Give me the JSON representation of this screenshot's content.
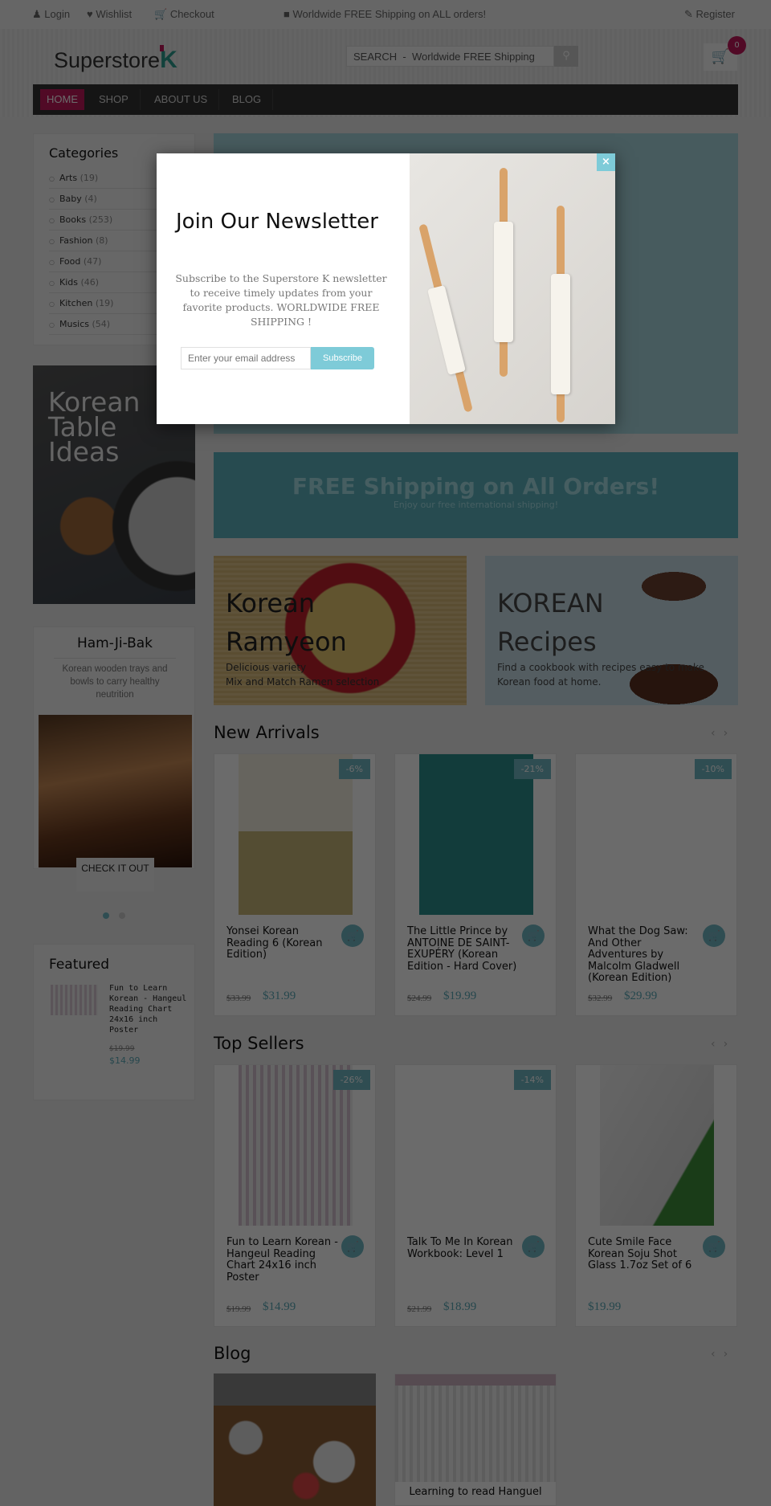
{
  "topbar": {
    "login": "Login",
    "wishlist": "Wishlist",
    "checkout": "Checkout",
    "shipping": "Worldwide FREE Shipping on ALL orders!",
    "register": "Register"
  },
  "header": {
    "logo": "Superstore",
    "logo_k": "K",
    "search_placeholder": "SEARCH  -  Worldwide FREE Shipping",
    "cart_count": "0"
  },
  "nav": [
    "HOME",
    "SHOP",
    "ABOUT US",
    "BLOG"
  ],
  "colors": {
    "accent": "#c2185b",
    "teal": "#6fb7c4",
    "nav_bg": "#333333"
  },
  "sidebar": {
    "categories_title": "Categories",
    "categories": [
      {
        "name": "Arts",
        "count": "(19)"
      },
      {
        "name": "Baby",
        "count": "(4)"
      },
      {
        "name": "Books",
        "count": "(253)"
      },
      {
        "name": "Fashion",
        "count": "(8)"
      },
      {
        "name": "Food",
        "count": "(47)"
      },
      {
        "name": "Kids",
        "count": "(46)"
      },
      {
        "name": "Kitchen",
        "count": "(19)"
      },
      {
        "name": "Musics",
        "count": "(54)"
      }
    ],
    "banner_text": "Korean Table Ideas",
    "promo": {
      "title": "Ham-Ji-Bak",
      "text": "Korean wooden trays and bowls to carry healthy neutrition",
      "button": "CHECK IT OUT"
    },
    "featured": {
      "title": "Featured",
      "name": "Fun to Learn Korean - Hangeul Reading Chart 24x16 inch Poster",
      "old_price": "$19.99",
      "price": "$14.99"
    }
  },
  "banners": {
    "shipping_title": "FREE Shipping on All Orders!",
    "shipping_sub": "Enjoy our free international shipping!",
    "ramyeon": {
      "title1": "Korean",
      "title2": "Ramyeon",
      "line1": "Delicious variety",
      "line2": "Mix and Match Ramen selection"
    },
    "recipes": {
      "title1": "KOREAN",
      "title2": "Recipes",
      "line1": "Find a cookbook with recipes easy to make",
      "line2": "Korean food at home."
    }
  },
  "new_arrivals": {
    "title": "New Arrivals",
    "items": [
      {
        "name": "Yonsei Korean Reading 6 (Korean Edition)",
        "discount": "-6%",
        "old_price": "$33.99",
        "price": "$31.99"
      },
      {
        "name": "The Little Prince by ANTOINE DE SAINT-EXUPÉRY (Korean Edition - Hard Cover)",
        "discount": "-21%",
        "old_price": "$24.99",
        "price": "$19.99"
      },
      {
        "name": "What the Dog Saw: And Other Adventures by Malcolm Gladwell (Korean Edition)",
        "discount": "-10%",
        "old_price": "$32.99",
        "price": "$29.99"
      }
    ]
  },
  "top_sellers": {
    "title": "Top Sellers",
    "items": [
      {
        "name": "Fun to Learn Korean - Hangeul Reading Chart 24x16 inch Poster",
        "discount": "-26%",
        "old_price": "$19.99",
        "price": "$14.99"
      },
      {
        "name": "Talk To Me In Korean Workbook: Level 1",
        "discount": "-14%",
        "old_price": "$21.99",
        "price": "$18.99"
      },
      {
        "name": "Cute Smile Face Korean Soju Shot Glass 1.7oz Set of 6",
        "price": "$19.99"
      }
    ]
  },
  "blog": {
    "title": "Blog",
    "post2": "Learning to read Hanguel"
  },
  "modal": {
    "title": "Join Our Newsletter",
    "text": "Subscribe to the Superstore K newsletter to receive timely updates from your favorite products. WORLDWIDE FREE SHIPPING !",
    "email_placeholder": "Enter your email address",
    "subscribe": "Subscribe",
    "close": "×"
  }
}
